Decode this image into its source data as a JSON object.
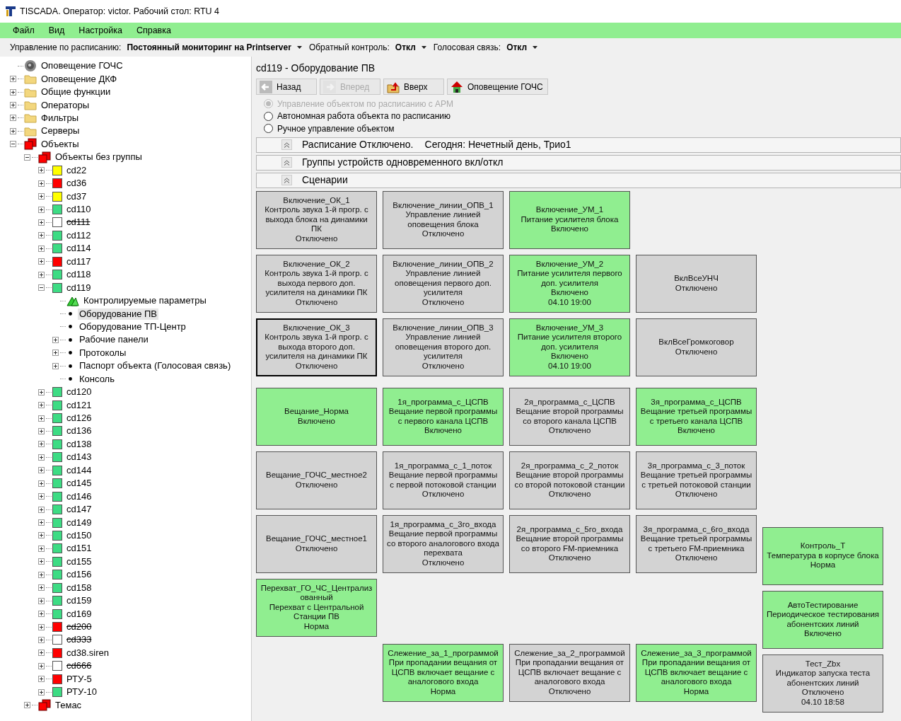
{
  "window": {
    "title": "TISCADA.  Оператор: victor.  Рабочий стол: RTU 4"
  },
  "menu": [
    "Файл",
    "Вид",
    "Настройка",
    "Справка"
  ],
  "toolbar": [
    {
      "label": "Управление по расписанию:",
      "value": "Постоянный мониторинг на Printserver"
    },
    {
      "label": "Обратный контроль:",
      "value": "Откл"
    },
    {
      "label": "Голосовая связь:",
      "value": "Откл"
    }
  ],
  "tree": [
    {
      "label": "Оповещение ГОЧС",
      "kind": "siren",
      "selected": false
    },
    {
      "label": "Оповещение ДКФ",
      "kind": "folder",
      "expanded": false,
      "selected": false
    },
    {
      "label": "Общие функции",
      "kind": "folder",
      "expanded": false,
      "selected": false
    },
    {
      "label": "Операторы",
      "kind": "folder",
      "expanded": false,
      "selected": false
    },
    {
      "label": "Фильтры",
      "kind": "folder",
      "expanded": false,
      "selected": false
    },
    {
      "label": "Серверы",
      "kind": "folder",
      "expanded": false,
      "selected": false
    },
    {
      "label": "Объекты",
      "kind": "objects",
      "expanded": true,
      "selected": false,
      "children": [
        {
          "label": "Объекты без группы",
          "kind": "objects",
          "expanded": true,
          "selected": false,
          "children": [
            {
              "label": "cd22",
              "kind": "status",
              "color": "#ffff00",
              "expanded": false,
              "selected": false,
              "disabled": false
            },
            {
              "label": "cd36",
              "kind": "status",
              "color": "#ff0000",
              "expanded": false,
              "selected": false,
              "disabled": false
            },
            {
              "label": "cd37",
              "kind": "status",
              "color": "#ffff00",
              "expanded": false,
              "selected": false,
              "disabled": false
            },
            {
              "label": "cd110",
              "kind": "status",
              "color": "#3ddc84",
              "expanded": false,
              "selected": false,
              "disabled": false
            },
            {
              "label": "cd111",
              "kind": "status",
              "color": "#ffffff",
              "expanded": false,
              "selected": false,
              "disabled": true
            },
            {
              "label": "cd112",
              "kind": "status",
              "color": "#3ddc84",
              "expanded": false,
              "selected": false,
              "disabled": false
            },
            {
              "label": "cd114",
              "kind": "status",
              "color": "#3ddc84",
              "expanded": false,
              "selected": false,
              "disabled": false
            },
            {
              "label": "cd117",
              "kind": "status",
              "color": "#ff0000",
              "expanded": false,
              "selected": false,
              "disabled": false
            },
            {
              "label": "cd118",
              "kind": "status",
              "color": "#3ddc84",
              "expanded": false,
              "selected": false,
              "disabled": false
            },
            {
              "label": "cd119",
              "kind": "status",
              "color": "#3ddc84",
              "expanded": true,
              "selected": false,
              "disabled": false,
              "children": [
                {
                  "label": "Контролируемые параметры",
                  "kind": "params",
                  "selected": false
                },
                {
                  "label": "Оборудование ПВ",
                  "kind": "bullet",
                  "selected": true
                },
                {
                  "label": "Оборудование ТП-Центр",
                  "kind": "bullet",
                  "selected": false
                },
                {
                  "label": "Рабочие панели",
                  "kind": "bullet",
                  "expanded": false,
                  "selected": false
                },
                {
                  "label": "Протоколы",
                  "kind": "bullet",
                  "expanded": false,
                  "selected": false
                },
                {
                  "label": "Паспорт объекта (Голосовая связь)",
                  "kind": "bullet",
                  "expanded": false,
                  "selected": false
                },
                {
                  "label": "Консоль",
                  "kind": "bullet",
                  "selected": false
                }
              ]
            },
            {
              "label": "cd120",
              "kind": "status",
              "color": "#3ddc84",
              "expanded": false,
              "selected": false,
              "disabled": false
            },
            {
              "label": "cd121",
              "kind": "status",
              "color": "#3ddc84",
              "expanded": false,
              "selected": false,
              "disabled": false
            },
            {
              "label": "cd126",
              "kind": "status",
              "color": "#3ddc84",
              "expanded": false,
              "selected": false,
              "disabled": false
            },
            {
              "label": "cd136",
              "kind": "status",
              "color": "#3ddc84",
              "expanded": false,
              "selected": false,
              "disabled": false
            },
            {
              "label": "cd138",
              "kind": "status",
              "color": "#3ddc84",
              "expanded": false,
              "selected": false,
              "disabled": false
            },
            {
              "label": "cd143",
              "kind": "status",
              "color": "#3ddc84",
              "expanded": false,
              "selected": false,
              "disabled": false
            },
            {
              "label": "cd144",
              "kind": "status",
              "color": "#3ddc84",
              "expanded": false,
              "selected": false,
              "disabled": false
            },
            {
              "label": "cd145",
              "kind": "status",
              "color": "#3ddc84",
              "expanded": false,
              "selected": false,
              "disabled": false
            },
            {
              "label": "cd146",
              "kind": "status",
              "color": "#3ddc84",
              "expanded": false,
              "selected": false,
              "disabled": false
            },
            {
              "label": "cd147",
              "kind": "status",
              "color": "#3ddc84",
              "expanded": false,
              "selected": false,
              "disabled": false
            },
            {
              "label": "cd149",
              "kind": "status",
              "color": "#3ddc84",
              "expanded": false,
              "selected": false,
              "disabled": false
            },
            {
              "label": "cd150",
              "kind": "status",
              "color": "#3ddc84",
              "expanded": false,
              "selected": false,
              "disabled": false
            },
            {
              "label": "cd151",
              "kind": "status",
              "color": "#3ddc84",
              "expanded": false,
              "selected": false,
              "disabled": false
            },
            {
              "label": "cd155",
              "kind": "status",
              "color": "#3ddc84",
              "expanded": false,
              "selected": false,
              "disabled": false
            },
            {
              "label": "cd156",
              "kind": "status",
              "color": "#3ddc84",
              "expanded": false,
              "selected": false,
              "disabled": false
            },
            {
              "label": "cd158",
              "kind": "status",
              "color": "#3ddc84",
              "expanded": false,
              "selected": false,
              "disabled": false
            },
            {
              "label": "cd159",
              "kind": "status",
              "color": "#3ddc84",
              "expanded": false,
              "selected": false,
              "disabled": false
            },
            {
              "label": "cd169",
              "kind": "status",
              "color": "#3ddc84",
              "expanded": false,
              "selected": false,
              "disabled": false
            },
            {
              "label": "cd200",
              "kind": "status",
              "color": "#ff0000",
              "expanded": false,
              "selected": false,
              "disabled": true
            },
            {
              "label": "cd333",
              "kind": "status",
              "color": "#ffffff",
              "expanded": false,
              "selected": false,
              "disabled": true
            },
            {
              "label": "cd38.siren",
              "kind": "status",
              "color": "#ff0000",
              "expanded": false,
              "selected": false,
              "disabled": false
            },
            {
              "label": "cd666",
              "kind": "status",
              "color": "#ffffff",
              "expanded": false,
              "selected": false,
              "disabled": true
            },
            {
              "label": "РТУ-5",
              "kind": "status",
              "color": "#ff0000",
              "expanded": false,
              "selected": false,
              "disabled": false
            },
            {
              "label": "РТУ-10",
              "kind": "status",
              "color": "#3ddc84",
              "expanded": false,
              "selected": false,
              "disabled": false
            }
          ]
        },
        {
          "label": "Темас",
          "kind": "objects",
          "expanded": false,
          "selected": false
        }
      ]
    }
  ],
  "content": {
    "title": "cd119 - Оборудование ПВ",
    "nav_buttons": [
      {
        "label": "Назад",
        "disabled": false
      },
      {
        "label": "Вперед",
        "disabled": true
      },
      {
        "label": "Вверх",
        "disabled": false
      },
      {
        "label": "Оповещение ГОЧС",
        "disabled": false
      }
    ],
    "modes": [
      {
        "label": "Управление объектом по расписанию с АРМ",
        "selected": true,
        "disabled": true
      },
      {
        "label": "Автономная работа объекта по расписанию",
        "selected": false,
        "disabled": false
      },
      {
        "label": "Ручное управление объектом",
        "selected": false,
        "disabled": false
      }
    ],
    "sections": [
      {
        "title": "Расписание Отключено.",
        "note": "Сегодня: Нечетный день, Трио1"
      },
      {
        "title": "Группы устройств одновременного вкл/откл"
      },
      {
        "title": "Сценарии"
      }
    ],
    "tile_rows": [
      [
        {
          "name": "Включение_ОК_1",
          "description": "Контроль звука 1-й прогр. с выхода блока на динамики ПК",
          "status": "Отключено",
          "on": false,
          "selected": false
        },
        {
          "name": "Включение_линии_ОПВ_1",
          "description": "Управление линией оповещения блока",
          "status": "Отключено",
          "on": false,
          "selected": false
        },
        {
          "name": "Включение_УМ_1",
          "description": "Питание усилителя блока",
          "status": "Включено",
          "on": true,
          "selected": false
        },
        null
      ],
      [
        {
          "name": "Включение_ОК_2",
          "description": "Контроль звука 1-й прогр. с выхода первого доп. усилителя на динамики ПК",
          "status": "Отключено",
          "on": false,
          "selected": false
        },
        {
          "name": "Включение_линии_ОПВ_2",
          "description": "Управление линией оповещения первого доп. усилителя",
          "status": "Отключено",
          "on": false,
          "selected": false
        },
        {
          "name": "Включение_УМ_2",
          "description": "Питание усилителя первого доп. усилителя",
          "status": "Включено",
          "time": "04.10 19:00",
          "on": true,
          "selected": false
        },
        {
          "name": "ВклВсеУНЧ",
          "status": "Отключено",
          "on": false,
          "selected": false
        }
      ],
      [
        {
          "name": "Включение_ОК_3",
          "description": "Контроль звука 1-й прогр. с выхода второго доп. усилителя на динамики ПК",
          "status": "Отключено",
          "on": false,
          "selected": true
        },
        {
          "name": "Включение_линии_ОПВ_3",
          "description": "Управление линией оповещения второго доп. усилителя",
          "status": "Отключено",
          "on": false,
          "selected": false
        },
        {
          "name": "Включение_УМ_3",
          "description": "Питание усилителя второго доп. усилителя",
          "status": "Включено",
          "time": "04.10 19:00",
          "on": true,
          "selected": false
        },
        {
          "name": "ВклВсеГромкоговор",
          "status": "Отключено",
          "on": false,
          "selected": false
        }
      ],
      [
        {
          "name": "Вещание_Норма",
          "status": "Включено",
          "on": true,
          "selected": false
        },
        {
          "name": "1я_программа_с_ЦСПВ",
          "description": "Вещание первой программы с первого канала ЦСПВ",
          "status": "Включено",
          "on": true,
          "selected": false
        },
        {
          "name": "2я_программа_с_ЦСПВ",
          "description": "Вещание второй программы со второго канала ЦСПВ",
          "status": "Отключено",
          "on": false,
          "selected": false
        },
        {
          "name": "3я_программа_с_ЦСПВ",
          "description": "Вещание третьей программы с третьего канала ЦСПВ",
          "status": "Включено",
          "on": true,
          "selected": false
        }
      ],
      [
        {
          "name": "Вещание_ГОЧС_местное2",
          "status": "Отключено",
          "on": false,
          "selected": false
        },
        {
          "name": "1я_программа_с_1_поток",
          "description": "Вещание первой программы с первой потоковой станции",
          "status": "Отключено",
          "on": false,
          "selected": false
        },
        {
          "name": "2я_программа_с_2_поток",
          "description": "Вещание второй программы со второй потоковой станции",
          "status": "Отключено",
          "on": false,
          "selected": false
        },
        {
          "name": "3я_программа_с_3_поток",
          "description": "Вещание третьей программы с третьей потоковой станции",
          "status": "Отключено",
          "on": false,
          "selected": false
        }
      ],
      [
        {
          "name": "Вещание_ГОЧС_местное1",
          "status": "Отключено",
          "on": false,
          "selected": false
        },
        {
          "name": "1я_программа_с_3го_входа",
          "description": "Вещание первой программы со второго  аналогового входа перехвата",
          "status": "Отключено",
          "on": false,
          "selected": false
        },
        {
          "name": "2я_программа_с_5го_входа",
          "description": "Вещание второй программы со второго FM-приемника",
          "status": "Отключено",
          "on": false,
          "selected": false
        },
        {
          "name": "3я_программа_с_6го_входа",
          "description": "Вещание третьей программы с третьего FM-приемника",
          "status": "Отключено",
          "on": false,
          "selected": false
        }
      ],
      [
        {
          "name": "Перехват_ГО_ЧС_Централизованный",
          "description": "Перехват с Центральной Станции ПВ",
          "status": "Норма",
          "on": true,
          "selected": false
        },
        null,
        null,
        null
      ],
      [
        null,
        {
          "name": "Слежение_за_1_программой",
          "description": "При пропадании вещания от ЦСПВ включает вещание с аналогового входа",
          "status": "Норма",
          "on": true,
          "selected": false
        },
        {
          "name": "Слежение_за_2_программой",
          "description": "При пропадании вещания от ЦСПВ включает вещание с аналогового входа",
          "status": "Отключено",
          "on": false,
          "selected": false
        },
        {
          "name": "Слежение_за_3_программой",
          "description": "При пропадании вещания от ЦСПВ включает вещание с аналогового входа",
          "status": "Норма",
          "on": true,
          "selected": false
        }
      ]
    ],
    "side_tiles": [
      {
        "name": "Контроль_Т",
        "description": "Температура в корпусе блока",
        "status": "Норма",
        "on": true,
        "selected": false
      },
      {
        "name": "АвтоТестирование",
        "description": "Периодическое тестирования абонентских линий",
        "status": "Включено",
        "on": true,
        "selected": false
      },
      {
        "name": "Тест_Zbx",
        "description": "Индикатор запуска теста абонентских линий",
        "status": "Отключено",
        "time": "04.10 18:58",
        "on": false,
        "selected": false
      }
    ]
  }
}
